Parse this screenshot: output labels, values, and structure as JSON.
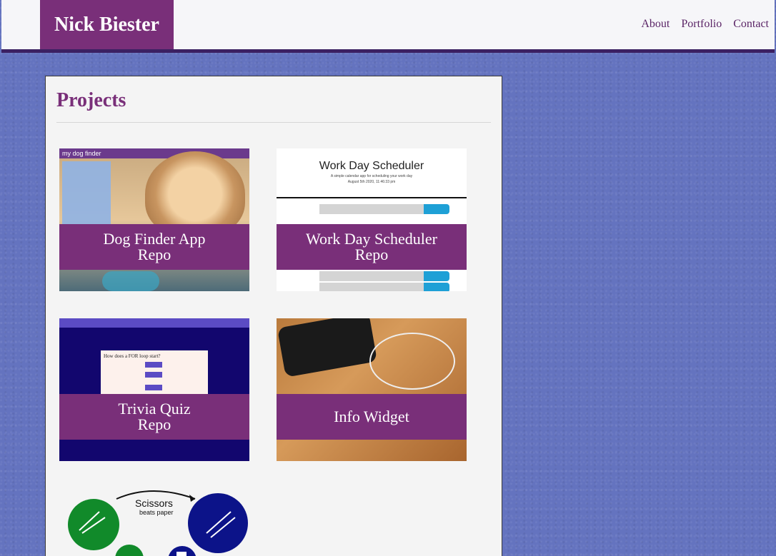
{
  "header": {
    "logo": "Nick Biester",
    "nav": [
      "About",
      "Portfolio",
      "Contact"
    ]
  },
  "projects": {
    "heading": "Projects",
    "items": [
      {
        "line1": "Dog Finder App",
        "line2": "Repo"
      },
      {
        "line1": "Work Day Scheduler",
        "line2": "Repo"
      },
      {
        "line1": "Trivia Quiz",
        "line2": "Repo"
      },
      {
        "line1": "Info Widget",
        "line2": ""
      }
    ]
  },
  "thumbnails": {
    "dog_bar": "my dog finder",
    "sched_title": "Work Day Scheduler",
    "sched_sub1": "A simple calendar app for scheduling your work day",
    "sched_sub2": "August 5th 2020, 11:46:33 pm",
    "quiz_question": "How does a FOR loop start?",
    "rps_title": "Scissors",
    "rps_sub": "beats paper"
  },
  "colors": {
    "brand": "#792f79",
    "page_bg": "#6473bf",
    "header_border": "#3b2062"
  }
}
